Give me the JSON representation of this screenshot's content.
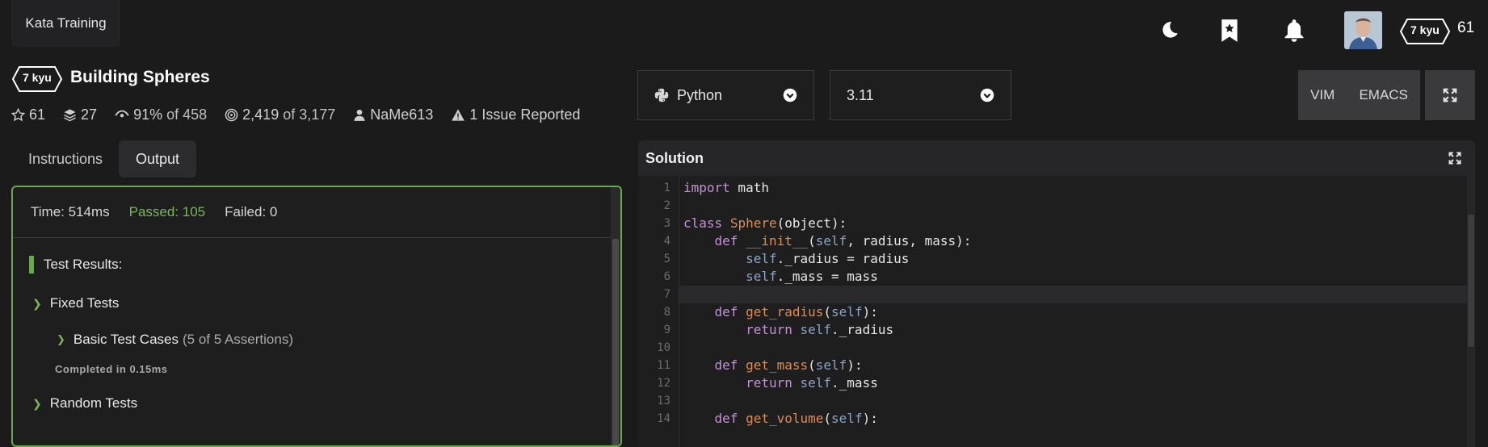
{
  "nav": {
    "kata_training_label": "Kata Training",
    "icons": [
      "moon-icon",
      "bookmark-star-icon",
      "bell-icon"
    ],
    "user_rank": "7 kyu",
    "user_honor": "61"
  },
  "kata": {
    "rank": "7 kyu",
    "title": "Building Spheres",
    "stats": {
      "stars": "61",
      "collections": "27",
      "satisfaction_pct": "91%",
      "satisfaction_of": "of 458",
      "completed": "2,419",
      "completed_of": "of 3,177",
      "author": "NaMe613",
      "issues": "1 Issue Reported"
    }
  },
  "tabs": [
    {
      "label": "Instructions",
      "active": false
    },
    {
      "label": "Output",
      "active": true
    }
  ],
  "output": {
    "time": "Time: 514ms",
    "passed": "Passed: 105",
    "failed": "Failed: 0",
    "results_heading": "Test Results:",
    "fixed_tests": "Fixed Tests",
    "basic_cases": "Basic Test Cases",
    "basic_cases_count": "(5 of 5 Assertions)",
    "completed_in": "Completed in 0.15ms",
    "random_tests": "Random Tests"
  },
  "editor": {
    "language": "Python",
    "version": "3.11",
    "modes": [
      "VIM",
      "EMACS"
    ],
    "solution_label": "Solution",
    "current_line": 7,
    "lines": [
      [
        [
          "import",
          "kw"
        ],
        [
          " math",
          "text"
        ]
      ],
      [],
      [
        [
          "class",
          "kw"
        ],
        [
          " ",
          "text"
        ],
        [
          "Sphere",
          "fn"
        ],
        [
          "(object):",
          "text"
        ]
      ],
      [
        [
          "    ",
          "text"
        ],
        [
          "def",
          "kw"
        ],
        [
          " ",
          "text"
        ],
        [
          "__init__",
          "fn"
        ],
        [
          "(",
          "text"
        ],
        [
          "self",
          "self"
        ],
        [
          ", radius, mass):",
          "text"
        ]
      ],
      [
        [
          "        ",
          "text"
        ],
        [
          "self",
          "self"
        ],
        [
          "._radius = radius",
          "text"
        ]
      ],
      [
        [
          "        ",
          "text"
        ],
        [
          "self",
          "self"
        ],
        [
          "._mass = mass",
          "text"
        ]
      ],
      [],
      [
        [
          "    ",
          "text"
        ],
        [
          "def",
          "kw"
        ],
        [
          " ",
          "text"
        ],
        [
          "get_radius",
          "fn"
        ],
        [
          "(",
          "text"
        ],
        [
          "self",
          "self"
        ],
        [
          "):",
          "text"
        ]
      ],
      [
        [
          "        ",
          "text"
        ],
        [
          "return",
          "kw"
        ],
        [
          " ",
          "text"
        ],
        [
          "self",
          "self"
        ],
        [
          "._radius",
          "text"
        ]
      ],
      [],
      [
        [
          "    ",
          "text"
        ],
        [
          "def",
          "kw"
        ],
        [
          " ",
          "text"
        ],
        [
          "get_mass",
          "fn"
        ],
        [
          "(",
          "text"
        ],
        [
          "self",
          "self"
        ],
        [
          "):",
          "text"
        ]
      ],
      [
        [
          "        ",
          "text"
        ],
        [
          "return",
          "kw"
        ],
        [
          " ",
          "text"
        ],
        [
          "self",
          "self"
        ],
        [
          "._mass",
          "text"
        ]
      ],
      [],
      [
        [
          "    ",
          "text"
        ],
        [
          "def",
          "kw"
        ],
        [
          " ",
          "text"
        ],
        [
          "get_volume",
          "fn"
        ],
        [
          "(",
          "text"
        ],
        [
          "self",
          "self"
        ],
        [
          "):",
          "text"
        ]
      ]
    ]
  }
}
